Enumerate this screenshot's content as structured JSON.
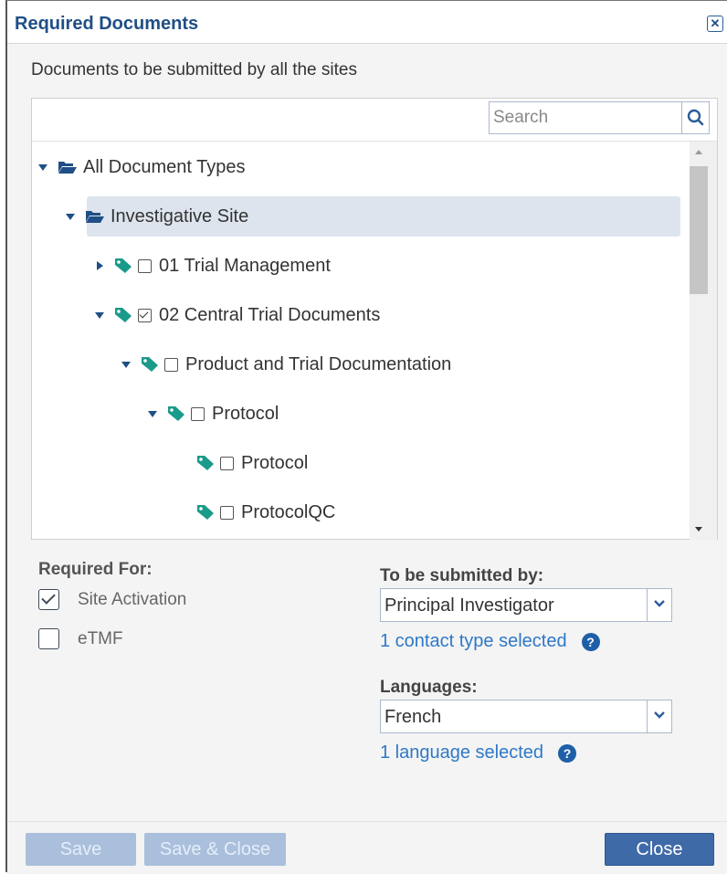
{
  "dialog": {
    "title": "Required Documents",
    "close_icon": "close-icon"
  },
  "subtitle": "Documents to be submitted by all the sites",
  "search": {
    "placeholder": "Search",
    "icon": "search-icon"
  },
  "tree": [
    {
      "label": "All Document Types",
      "expanded": true,
      "icon": "folder-open-icon",
      "checkbox": false
    },
    {
      "label": "Investigative Site",
      "expanded": true,
      "icon": "folder-open-icon",
      "checkbox": false,
      "selected": true
    },
    {
      "label": "01 Trial Management",
      "expanded": false,
      "icon": "tag-icon",
      "checkbox": true,
      "checked": false
    },
    {
      "label": "02 Central Trial Documents",
      "expanded": true,
      "icon": "tag-icon",
      "checkbox": true,
      "checked": true
    },
    {
      "label": "Product and Trial Documentation",
      "expanded": true,
      "icon": "tag-icon",
      "checkbox": true,
      "checked": false
    },
    {
      "label": "Protocol",
      "expanded": true,
      "icon": "tag-icon",
      "checkbox": true,
      "checked": false
    },
    {
      "label": "Protocol",
      "leaf": true,
      "icon": "tag-icon",
      "checkbox": true,
      "checked": false
    },
    {
      "label": "ProtocolQC",
      "leaf": true,
      "icon": "tag-icon",
      "checkbox": true,
      "checked": false
    }
  ],
  "required_for": {
    "label": "Required For:",
    "options": [
      {
        "label": "Site Activation",
        "checked": true
      },
      {
        "label": "eTMF",
        "checked": false
      }
    ]
  },
  "submitted_by": {
    "label": "To be submitted by:",
    "value": "Principal Investigator",
    "info": "1 contact type selected"
  },
  "languages": {
    "label": "Languages:",
    "value": "French",
    "info": "1 language selected"
  },
  "buttons": {
    "save": "Save",
    "save_close": "Save & Close",
    "close": "Close"
  },
  "colors": {
    "title": "#1f4f86",
    "link": "#2e78c7",
    "tag": "#1a9a8a",
    "primary_button": "#3f6aa8",
    "disabled_button": "#a9bfdc"
  }
}
